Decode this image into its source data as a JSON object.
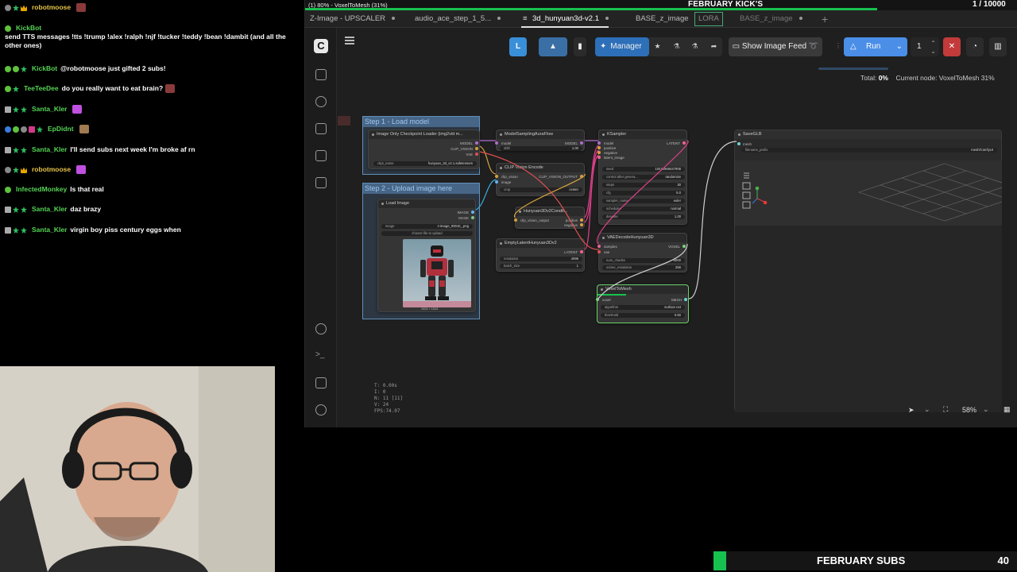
{
  "chat": {
    "messages": [
      {
        "user": "robotmoose",
        "user_color": "#e6c44a",
        "text": ""
      },
      {
        "user": "KickBot",
        "user_color": "#55d455",
        "text": "send TTS messages !tts !trump !alex !ralph !njf !tucker !teddy !bean !dambit (and all the other ones)"
      },
      {
        "user": "KickBot",
        "user_color": "#55d455",
        "text": "@robotmoose just gifted 2 subs!"
      },
      {
        "user": "TeeTeeDee",
        "user_color": "#55d455",
        "text": "do you really want to eat brain?"
      },
      {
        "user": "Santa_Kler",
        "user_color": "#55d455",
        "text": ""
      },
      {
        "user": "EpDidnt",
        "user_color": "#55d455",
        "text": ""
      },
      {
        "user": "Santa_Kler",
        "user_color": "#55d455",
        "text": "I'll send subs next week I'm broke af rn"
      },
      {
        "user": "robotmoose",
        "user_color": "#e6c44a",
        "text": ""
      },
      {
        "user": "InfectedMonkey",
        "user_color": "#55d455",
        "text": "Is that real"
      },
      {
        "user": "Santa_Kler",
        "user_color": "#55d455",
        "text": "daz brazy"
      },
      {
        "user": "Santa_Kler",
        "user_color": "#55d455",
        "text": "virgin boy piss century eggs when"
      }
    ]
  },
  "window": {
    "title": "(1) 80% - VoxelToMesh (31%)",
    "tabs": [
      {
        "label": "Z-Image - UPSCALER"
      },
      {
        "label": "audio_ace_step_1_5..."
      },
      {
        "label": "3d_hunyuan3d-v2.1"
      },
      {
        "label": "BASE_z_image"
      },
      {
        "label": "LORA"
      },
      {
        "label": "BASE_z_image"
      }
    ]
  },
  "overlay": {
    "kicks_label": "FEBRUARY KICK'S",
    "kicks_count": "1 / 10000",
    "subs_label": "FEBRUARY SUBS",
    "subs_count": "40"
  },
  "toolbar": {
    "l_label": "L",
    "manager_label": "Manager",
    "feed_label": "Show Image Feed",
    "run_label": "Run",
    "run_count": "1"
  },
  "status": {
    "total_label": "Total:",
    "total_value": "0%",
    "current_node": "Current node: VoxelToMesh 31%"
  },
  "groups": {
    "step1": "Step 1 - Load model",
    "step2": "Step 2 - Upload image here"
  },
  "nodes": {
    "ckpt": {
      "title": "Image Only Checkpoint Loader (img2vid m...",
      "out_model": "MODEL",
      "out_clip": "CLIP_VISION",
      "out_vae": "VAE",
      "w_name": "ckpt_name",
      "w_value": "hunyuan_3d_v2.1.safetensors"
    },
    "sampling": {
      "title": "ModelSamplingAuraFlow",
      "in_model": "model",
      "out_model": "MODEL",
      "w_shift": "shift",
      "w_shift_v": "1.00"
    },
    "clipvision": {
      "title": "CLIP Vision Encode",
      "in1": "clip_vision",
      "in2": "image",
      "out": "CLIP_VISION_OUTPUT",
      "w_crop": "crop",
      "w_crop_v": "center"
    },
    "hunyuancond": {
      "title": "Hunyuan3Dv2Condit...",
      "in": "clip_vision_output",
      "out_pos": "positive",
      "out_neg": "negative"
    },
    "emptylatent": {
      "title": "EmptyLatentHunyuan3Dv2",
      "out": "LATENT",
      "w_res": "resolution",
      "w_res_v": "4096",
      "w_batch": "batch_size",
      "w_batch_v": "1"
    },
    "ksampler": {
      "title": "KSampler",
      "in_model": "model",
      "in_pos": "positive",
      "in_neg": "negative",
      "in_latent": "latent_image",
      "out": "LATENT",
      "widgets": [
        {
          "k": "seed",
          "v": "10471968447908"
        },
        {
          "k": "control after genera...",
          "v": "randomize"
        },
        {
          "k": "steps",
          "v": "30"
        },
        {
          "k": "cfg",
          "v": "5.0"
        },
        {
          "k": "sampler_name",
          "v": "euler"
        },
        {
          "k": "scheduler",
          "v": "normal"
        },
        {
          "k": "denoise",
          "v": "1.00"
        }
      ]
    },
    "vaedecode": {
      "title": "VAEDecodeHunyuan3D",
      "in1": "samples",
      "in2": "vae",
      "out": "VOXEL",
      "w1": "num_chunks",
      "w1v": "8000",
      "w2": "octree_resolution",
      "w2v": "256"
    },
    "voxeltomesh": {
      "title": "VoxelToMesh",
      "in": "voxel",
      "out": "MESH",
      "w1": "algorithm",
      "w1v": "surface net",
      "w2": "threshold",
      "w2v": "0.60"
    },
    "loadimage": {
      "title": "Load Image",
      "out_image": "IMAGE",
      "out_mask": "MASK",
      "w_image": "image",
      "w_image_v": "z-image_00010_.png",
      "upload_label": "choose file to upload",
      "dims": "1024 × 1024"
    },
    "saveglb": {
      "title": "SaveGLB",
      "in": "mesh",
      "w_prefix": "filename_prefix",
      "w_prefix_v": "mesh/ComfyUI"
    }
  },
  "stats": {
    "lines": "T: 0.00s\nI: 0\nN: 11 [11]\nV: 24\nFPS:74.07"
  },
  "zoom": {
    "value": "58%"
  },
  "colors": {
    "accent_blue": "#4a8ee8",
    "green": "#17c14f",
    "group_blue": "#5f8fb8",
    "link_pink": "#e0408a",
    "link_blue": "#3ab0e0"
  }
}
